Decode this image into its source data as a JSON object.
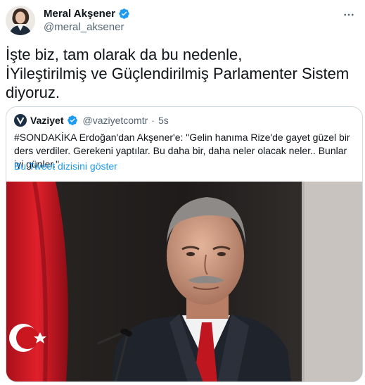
{
  "author": {
    "name": "Meral Akşener",
    "handle": "@meral_aksener",
    "verified": true
  },
  "tweet": {
    "text": "İşte biz, tam olarak da bu nedenle,\nİYileştirilmiş ve Güçlendirilmiş Parlamenter Sistem\ndiyoruz."
  },
  "quote": {
    "name": "Vaziyet",
    "handle": "@vaziyetcomtr",
    "separator": "·",
    "time": "5s",
    "text": "#SONDAKİKA Erdoğan'dan Akşener'e: \"Gelin hanıma Rize'de gayet güzel bir ders verdiler. Gerekeni yaptılar. Bu daha bir, daha neler olacak neler.. Bunlar iyi günler.\"",
    "thread_link": "Bu Tweet dizisini göster"
  },
  "icons": {
    "verified": "verified-badge-icon",
    "more": "more-options-icon"
  },
  "colors": {
    "accent": "#1d9bf0",
    "secondary_text": "#536471",
    "border": "#cfd9de"
  }
}
